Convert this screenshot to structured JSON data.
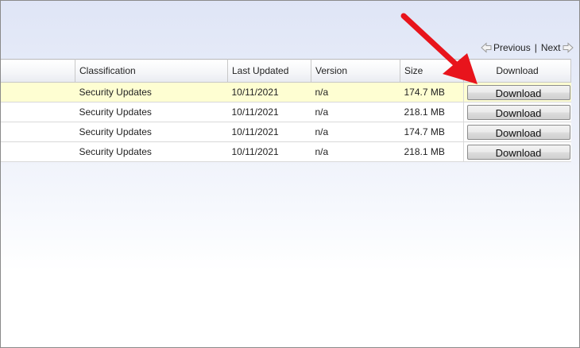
{
  "pager": {
    "previous_label": "Previous",
    "separator": "|",
    "next_label": "Next",
    "prev_icon": "left-arrow-icon",
    "next_icon": "right-arrow-icon"
  },
  "table": {
    "columns": [
      "",
      "Classification",
      "Last Updated",
      "Version",
      "Size",
      "Download"
    ],
    "rows": [
      {
        "classification": "Security Updates",
        "last_updated": "10/11/2021",
        "version": "n/a",
        "size": "174.7 MB",
        "button": "Download",
        "highlighted": true
      },
      {
        "classification": "Security Updates",
        "last_updated": "10/11/2021",
        "version": "n/a",
        "size": "218.1 MB",
        "button": "Download",
        "highlighted": false
      },
      {
        "classification": "Security Updates",
        "last_updated": "10/11/2021",
        "version": "n/a",
        "size": "174.7 MB",
        "button": "Download",
        "highlighted": false
      },
      {
        "classification": "Security Updates",
        "last_updated": "10/11/2021",
        "version": "n/a",
        "size": "218.1 MB",
        "button": "Download",
        "highlighted": false
      }
    ]
  },
  "colors": {
    "highlight_row": "#fefed2",
    "annotation_arrow": "#e8141c"
  },
  "annotation": {
    "icon": "red-pointer-arrow-icon"
  }
}
